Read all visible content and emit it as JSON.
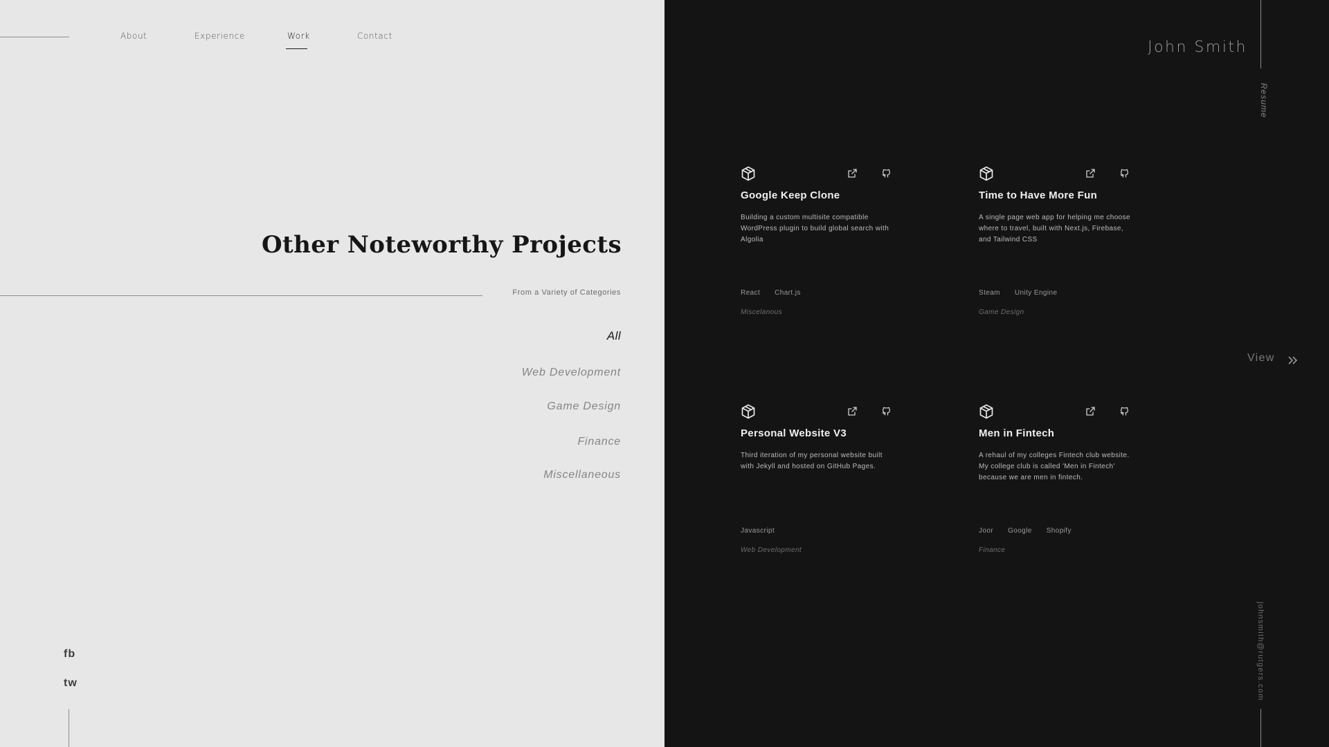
{
  "nav": {
    "items": [
      {
        "label": "About"
      },
      {
        "label": "Experience"
      },
      {
        "label": "Work"
      },
      {
        "label": "Contact"
      }
    ],
    "active": "Work"
  },
  "section": {
    "title": "Other Noteworthy Projects",
    "subtitle": "From a Variety of Categories"
  },
  "categories": {
    "active": "All",
    "items": [
      "All",
      "Web Development",
      "Game Design",
      "Finance",
      "Miscellaneous"
    ]
  },
  "social": [
    "fb",
    "tw"
  ],
  "owner": {
    "name": "John Smith",
    "resume_label": "Resume",
    "email": "johnsmith@rutgers.com"
  },
  "view_label": "View",
  "projects": [
    {
      "title": "Google Keep Clone",
      "description": "Building a custom multisite compatible WordPress plugin to build global search with Algolia",
      "tags": [
        "React",
        "Chart.js"
      ],
      "category": "Miscelanous"
    },
    {
      "title": "Time to Have More Fun",
      "description": "A single page web app for helping me choose where to travel, built with Next.js, Firebase, and Tailwind CSS",
      "tags": [
        "Steam",
        "Unity Engine"
      ],
      "category": "Game Design"
    },
    {
      "title": "Personal Website V3",
      "description": "Third iteration of my personal website built with Jekyll and hosted on GitHub Pages.",
      "tags": [
        "Javascript"
      ],
      "category": "Web Development"
    },
    {
      "title": "Men in Fintech",
      "description": "A rehaul of my colleges Fintech club website. My college club is called 'Men in Fintech' because we are men in fintech.",
      "tags": [
        "Joor",
        "Google",
        "Shopify"
      ],
      "category": "Finance"
    }
  ],
  "icons": {
    "card_logo": "package-cube-icon",
    "external_link": "external-link-icon",
    "repo": "github-icon",
    "view_more": "double-chevron-right-icon"
  },
  "colors": {
    "left_bg": "#e7e7e7",
    "right_bg": "#141414",
    "heading": "#161616",
    "card_title": "#f0f0f0"
  }
}
